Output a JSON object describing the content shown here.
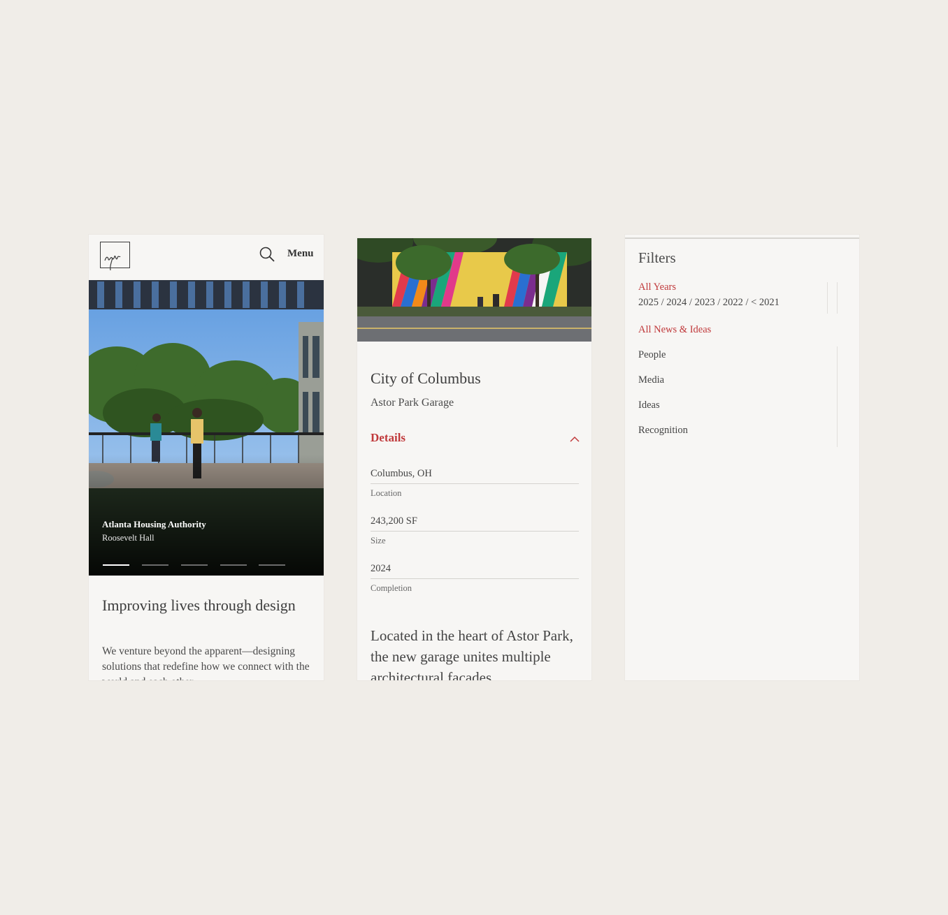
{
  "panel1": {
    "header": {
      "logo_icon": "signature-logo-icon",
      "search_icon": "search-icon",
      "menu_label": "Menu"
    },
    "hero": {
      "caption_title": "Atlanta Housing Authority",
      "caption_subtitle": "Roosevelt Hall",
      "slide_count": 5,
      "active_slide": 1
    },
    "intro": {
      "title": "Improving lives through design",
      "body": "We venture beyond the apparent—designing solutions that redefine how we connect with the world and each other."
    }
  },
  "panel2": {
    "client": "City of Columbus",
    "project": "Astor Park Garage",
    "details_label": "Details",
    "details_icon": "chevron-up-icon",
    "fields": [
      {
        "value": "Columbus, OH",
        "label": "Location"
      },
      {
        "value": "243,200 SF",
        "label": "Size"
      },
      {
        "value": "2024",
        "label": "Completion"
      }
    ],
    "description": "Located in the heart of Astor Park, the new garage unites multiple architectural facades"
  },
  "panel3": {
    "title": "Filters",
    "all_years": "All Years",
    "years": [
      "2025",
      "2024",
      "2023",
      "2022",
      "< 2021"
    ],
    "all_categories": "All News & Ideas",
    "categories": [
      "People",
      "Media",
      "Ideas",
      "Recognition"
    ]
  },
  "colors": {
    "background": "#f0ede8",
    "panel": "#f7f6f4",
    "accent": "#c0393b",
    "text": "#3a3a3a"
  }
}
